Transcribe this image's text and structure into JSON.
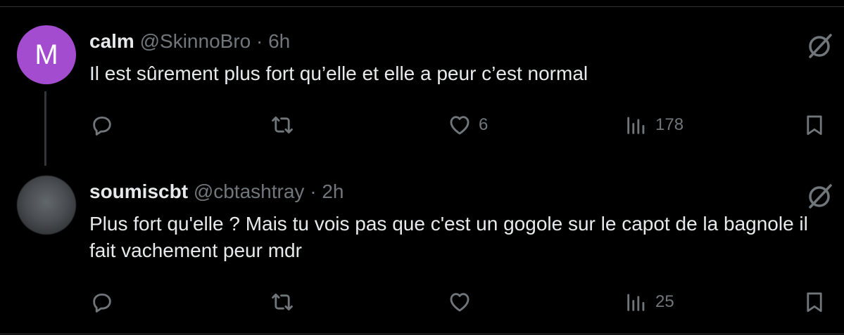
{
  "tweets": [
    {
      "avatar_letter": "M",
      "name": "calm",
      "handle": "@SkinnoBro",
      "separator": "·",
      "time": "6h",
      "text": "Il est sûrement plus fort qu’elle et elle a peur c’est normal",
      "likes": "6",
      "views": "178"
    },
    {
      "name": "soumiscbt",
      "handle": "@cbtashtray",
      "separator": "·",
      "time": "2h",
      "text": "Plus fort qu'elle ? Mais tu vois pas que c'est un gogole sur le capot de la bagnole il fait vachement peur mdr",
      "likes": "",
      "views": "25"
    }
  ],
  "icons": {
    "reply": "reply-icon",
    "repost": "repost-icon",
    "like": "heart-icon",
    "views": "views-icon",
    "bookmark": "bookmark-icon",
    "grok": "grok-icon"
  },
  "colors": {
    "background": "#000000",
    "text": "#e7e9ea",
    "secondary": "#71767b",
    "avatar_purple": "#a44ccf",
    "divider": "#2f3336"
  }
}
